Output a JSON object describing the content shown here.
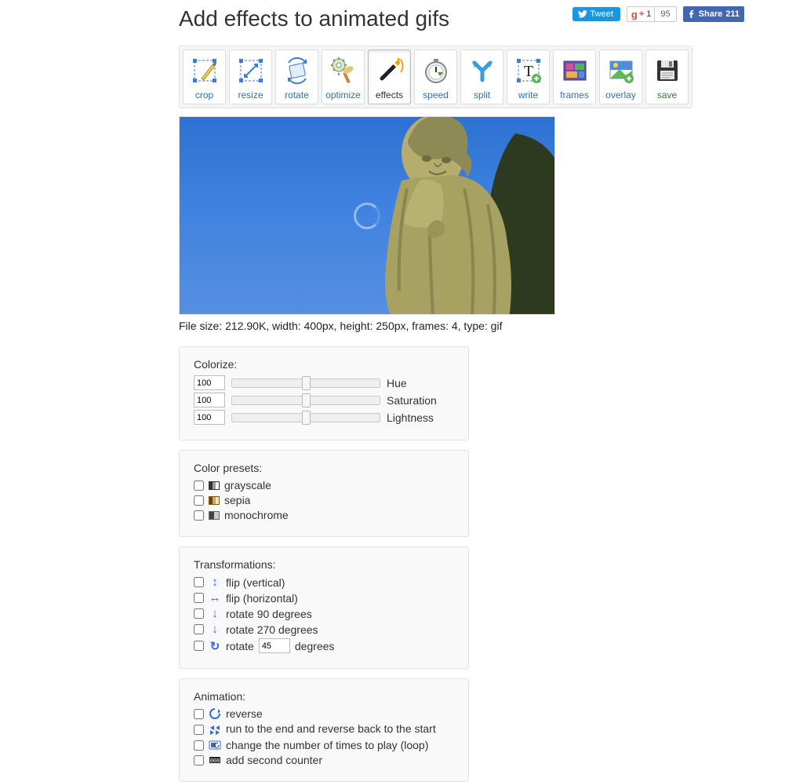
{
  "heading": "Add effects to animated gifs",
  "social": {
    "tweet": "Tweet",
    "gplus_count": "95",
    "fb_text": "Share",
    "fb_count": "211"
  },
  "toolbar": [
    {
      "key": "crop",
      "label": "crop"
    },
    {
      "key": "resize",
      "label": "resize"
    },
    {
      "key": "rotate",
      "label": "rotate"
    },
    {
      "key": "optimize",
      "label": "optimize"
    },
    {
      "key": "effects",
      "label": "effects",
      "active": true
    },
    {
      "key": "speed",
      "label": "speed"
    },
    {
      "key": "split",
      "label": "split"
    },
    {
      "key": "write",
      "label": "write"
    },
    {
      "key": "frames",
      "label": "frames"
    },
    {
      "key": "overlay",
      "label": "overlay"
    },
    {
      "key": "save",
      "label": "save"
    }
  ],
  "file_info": "File size: 212.90K, width: 400px, height: 250px, frames: 4, type: gif",
  "colorize": {
    "title": "Colorize:",
    "hue": {
      "value": "100",
      "label": "Hue"
    },
    "saturation": {
      "value": "100",
      "label": "Saturation"
    },
    "lightness": {
      "value": "100",
      "label": "Lightness"
    }
  },
  "presets": {
    "title": "Color presets:",
    "grayscale": "grayscale",
    "sepia": "sepia",
    "monochrome": "monochrome"
  },
  "transform": {
    "title": "Transformations:",
    "flipv": "flip (vertical)",
    "fliph": "flip (horizontal)",
    "rot90": "rotate 90 degrees",
    "rot270": "rotate 270 degrees",
    "rotn_pre": "rotate",
    "rotn_deg": "45",
    "rotn_post": "degrees"
  },
  "animation": {
    "title": "Animation:",
    "reverse": "reverse",
    "runback": "run to the end and reverse back to the start",
    "loop": "change the number of times to play (loop)",
    "counter": "add second counter"
  }
}
